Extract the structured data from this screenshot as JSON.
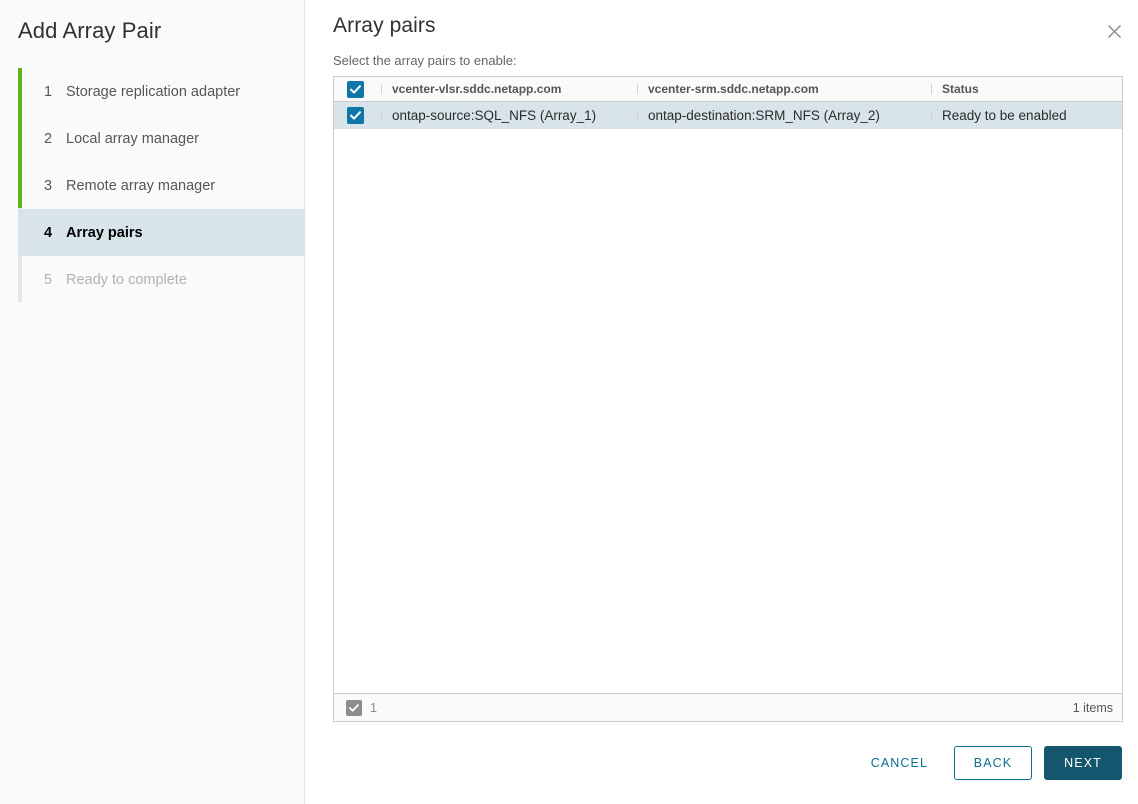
{
  "wizard": {
    "title": "Add Array Pair",
    "steps": [
      {
        "num": "1",
        "label": "Storage replication adapter",
        "state": "done"
      },
      {
        "num": "2",
        "label": "Local array manager",
        "state": "done"
      },
      {
        "num": "3",
        "label": "Remote array manager",
        "state": "done"
      },
      {
        "num": "4",
        "label": "Array pairs",
        "state": "current"
      },
      {
        "num": "5",
        "label": "Ready to complete",
        "state": "disabled"
      }
    ]
  },
  "main": {
    "title": "Array pairs",
    "subtitle": "Select the array pairs to enable:",
    "close_icon": "close-icon"
  },
  "grid": {
    "columns": [
      {
        "key": "check",
        "label": ""
      },
      {
        "key": "local",
        "label": "vcenter-vlsr.sddc.netapp.com"
      },
      {
        "key": "remote",
        "label": "vcenter-srm.sddc.netapp.com"
      },
      {
        "key": "status",
        "label": "Status"
      }
    ],
    "header_checkbox": {
      "checked": true,
      "color": "#0f76a8"
    },
    "rows": [
      {
        "checked": true,
        "local": "ontap-source:SQL_NFS (Array_1)",
        "remote": "ontap-destination:SRM_NFS (Array_2)",
        "status": "Ready to be enabled",
        "selected": true
      }
    ],
    "footer": {
      "checkbox_checked": true,
      "selected_count": "1",
      "items_label": "1 items"
    }
  },
  "actions": {
    "cancel": "CANCEL",
    "back": "BACK",
    "next": "NEXT"
  },
  "colors": {
    "progress_green": "#60b515",
    "accent_blue": "#0f76a8",
    "primary_button": "#15566f",
    "selection": "#d8e3ea"
  }
}
